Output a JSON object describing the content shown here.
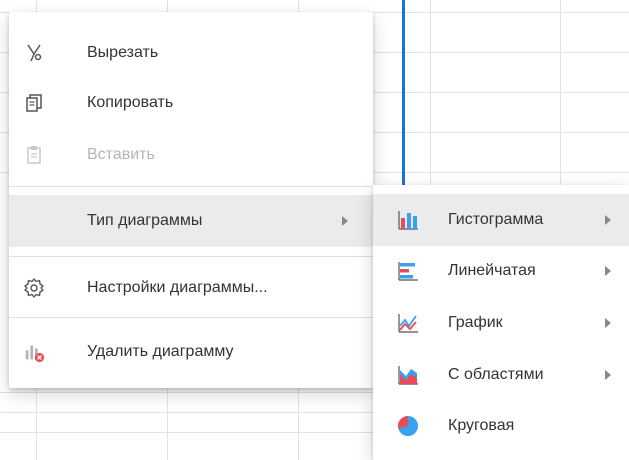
{
  "context_menu": {
    "items": [
      {
        "label": "Вырезать",
        "icon": "scissors-icon",
        "enabled": true
      },
      {
        "label": "Копировать",
        "icon": "copy-icon",
        "enabled": true
      },
      {
        "label": "Вставить",
        "icon": "paste-icon",
        "enabled": false
      },
      {
        "label": "Тип диаграммы",
        "icon": "",
        "has_submenu": true,
        "highlighted": true
      },
      {
        "label": "Настройки диаграммы...",
        "icon": "gear-icon",
        "enabled": true
      },
      {
        "label": "Удалить диаграмму",
        "icon": "delete-chart-icon",
        "enabled": true
      }
    ]
  },
  "chart_type_submenu": {
    "items": [
      {
        "label": "Гистограмма",
        "icon": "bar-chart-icon",
        "has_submenu": true,
        "highlighted": true
      },
      {
        "label": "Линейчатая",
        "icon": "horizontal-bar-chart-icon",
        "has_submenu": true
      },
      {
        "label": "График",
        "icon": "line-chart-icon",
        "has_submenu": true
      },
      {
        "label": "С областями",
        "icon": "area-chart-icon",
        "has_submenu": true
      },
      {
        "label": "Круговая",
        "icon": "pie-chart-icon",
        "has_submenu": false
      }
    ]
  },
  "colors": {
    "accent_blue": "#1a73e8",
    "chart_red": "#e84c56",
    "chart_blue": "#3aa0f0",
    "highlight": "#ebebeb",
    "disabled_text": "#b5b5b5"
  }
}
